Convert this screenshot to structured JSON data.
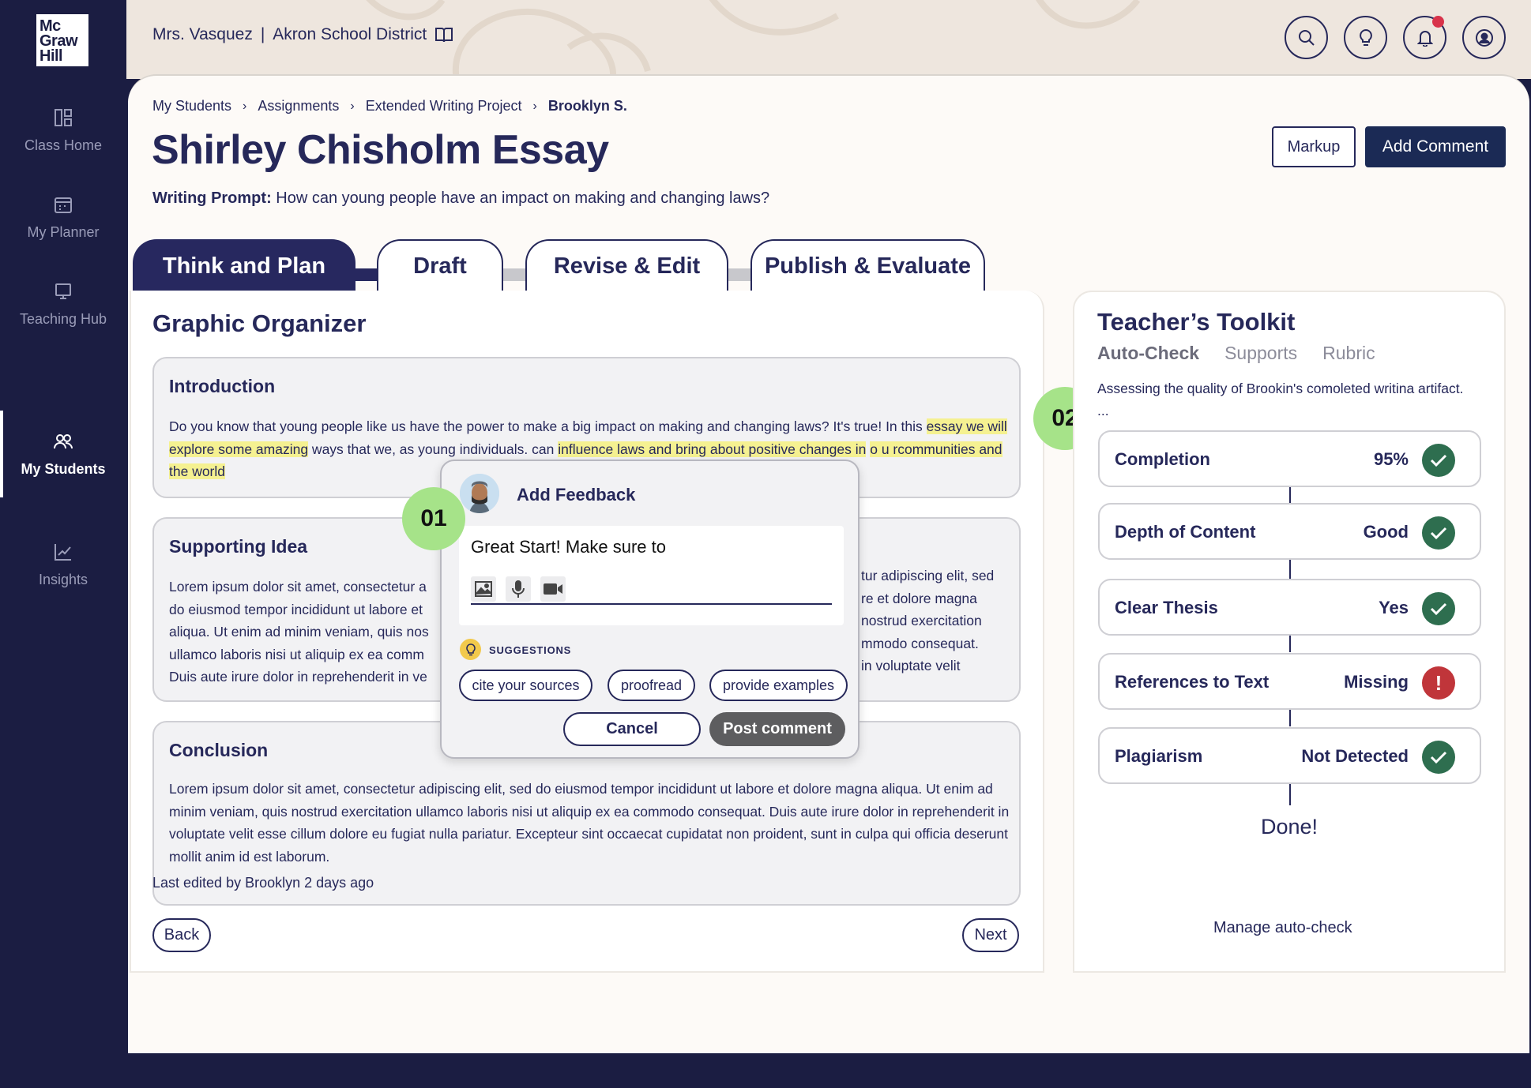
{
  "sidebar": {
    "logo": [
      "Mc",
      "Graw",
      "Hill"
    ],
    "items": [
      {
        "label": "Class Home",
        "icon": "grid-icon"
      },
      {
        "label": "My Planner",
        "icon": "calendar-icon"
      },
      {
        "label": "Teaching Hub",
        "icon": "monitor-icon"
      },
      {
        "label": "My Students",
        "icon": "people-icon"
      },
      {
        "label": "Insights",
        "icon": "chart-icon"
      }
    ]
  },
  "header": {
    "teacher": "Mrs. Vasquez",
    "separator": "|",
    "district": "Akron School District"
  },
  "breadcrumb": [
    "My Students",
    "Assignments",
    "Extended Writing Project",
    "Brooklyn S."
  ],
  "page": {
    "title": "Shirley Chisholm Essay",
    "prompt_label": "Writing Prompt:",
    "prompt_text": "How can young people have an impact on making and changing laws?",
    "markup_label": "Markup",
    "add_comment_label": "Add Comment"
  },
  "tabs": [
    "Think and Plan",
    "Draft",
    "Revise & Edit",
    "Publish & Evaluate"
  ],
  "organizer": {
    "title": "Graphic Organizer",
    "intro": {
      "heading": "Introduction",
      "text_a": "Do you know that young people like us have the power to make a big impact on making and changing laws? It's true! In this ",
      "text_hl1": "essay we will explore some amazing",
      "text_b": " ways that we, as young individuals. can ",
      "text_hl2": "influence laws and bring about positive changes in",
      "text_hl3": "o u rcommunities and the world"
    },
    "supporting": {
      "heading": "Supporting Idea",
      "left_lines": [
        "Lorem ipsum dolor sit amet, consectetur a",
        "do eiusmod tempor incididunt ut labore et",
        "aliqua. Ut enim ad minim veniam, quis nos",
        "ullamco laboris nisi ut aliquip ex ea comm",
        "Duis aute irure dolor in reprehenderit in ve"
      ],
      "right_lines": [
        "tur adipiscing elit, sed",
        "re et dolore magna",
        "nostrud exercitation",
        "mmodo consequat.",
        "in voluptate velit"
      ]
    },
    "conclusion": {
      "heading": "Conclusion",
      "text": "Lorem ipsum dolor sit amet, consectetur adipiscing elit, sed do eiusmod tempor incididunt ut labore et dolore magna aliqua. Ut enim ad minim veniam, quis nostrud exercitation ullamco laboris nisi ut aliquip ex ea commodo consequat. Duis aute irure dolor in reprehenderit in voluptate velit esse cillum dolore eu fugiat nulla pariatur. Excepteur sint occaecat cupidatat non proident, sunt in culpa qui officia deserunt mollit anim id est laborum."
    },
    "last_edited": "Last edited by Brooklyn 2 days ago",
    "back_label": "Back",
    "next_label": "Next"
  },
  "feedback": {
    "title": "Add Feedback",
    "input_value": "Great Start! Make sure to",
    "suggestions_label": "SUGGESTIONS",
    "chips": [
      "cite your sources",
      "proofread",
      "provide examples"
    ],
    "cancel_label": "Cancel",
    "post_label": "Post comment"
  },
  "markers": {
    "one": "01",
    "two": "02"
  },
  "toolkit": {
    "title": "Teacher’s Toolkit",
    "tabs": [
      "Auto-Check",
      "Supports",
      "Rubric"
    ],
    "description": "Assessing the quality of Brookin's comoleted writina artifact. ...",
    "checks": [
      {
        "label": "Completion",
        "value": "95%",
        "status": "ok"
      },
      {
        "label": "Depth of Content",
        "value": "Good",
        "status": "ok"
      },
      {
        "label": "Clear Thesis",
        "value": "Yes",
        "status": "ok"
      },
      {
        "label": "References to Text",
        "value": "Missing",
        "status": "warn",
        "warn_symbol": "!"
      },
      {
        "label": "Plagiarism",
        "value": "Not Detected",
        "status": "ok"
      }
    ],
    "done_label": "Done!",
    "manage_label": "Manage auto-check"
  },
  "colors": {
    "navy": "#1b1d42",
    "accent_green": "#a6e389",
    "ok": "#2e6e4f",
    "warn": "#c0353a",
    "highlight": "#f5f191"
  }
}
